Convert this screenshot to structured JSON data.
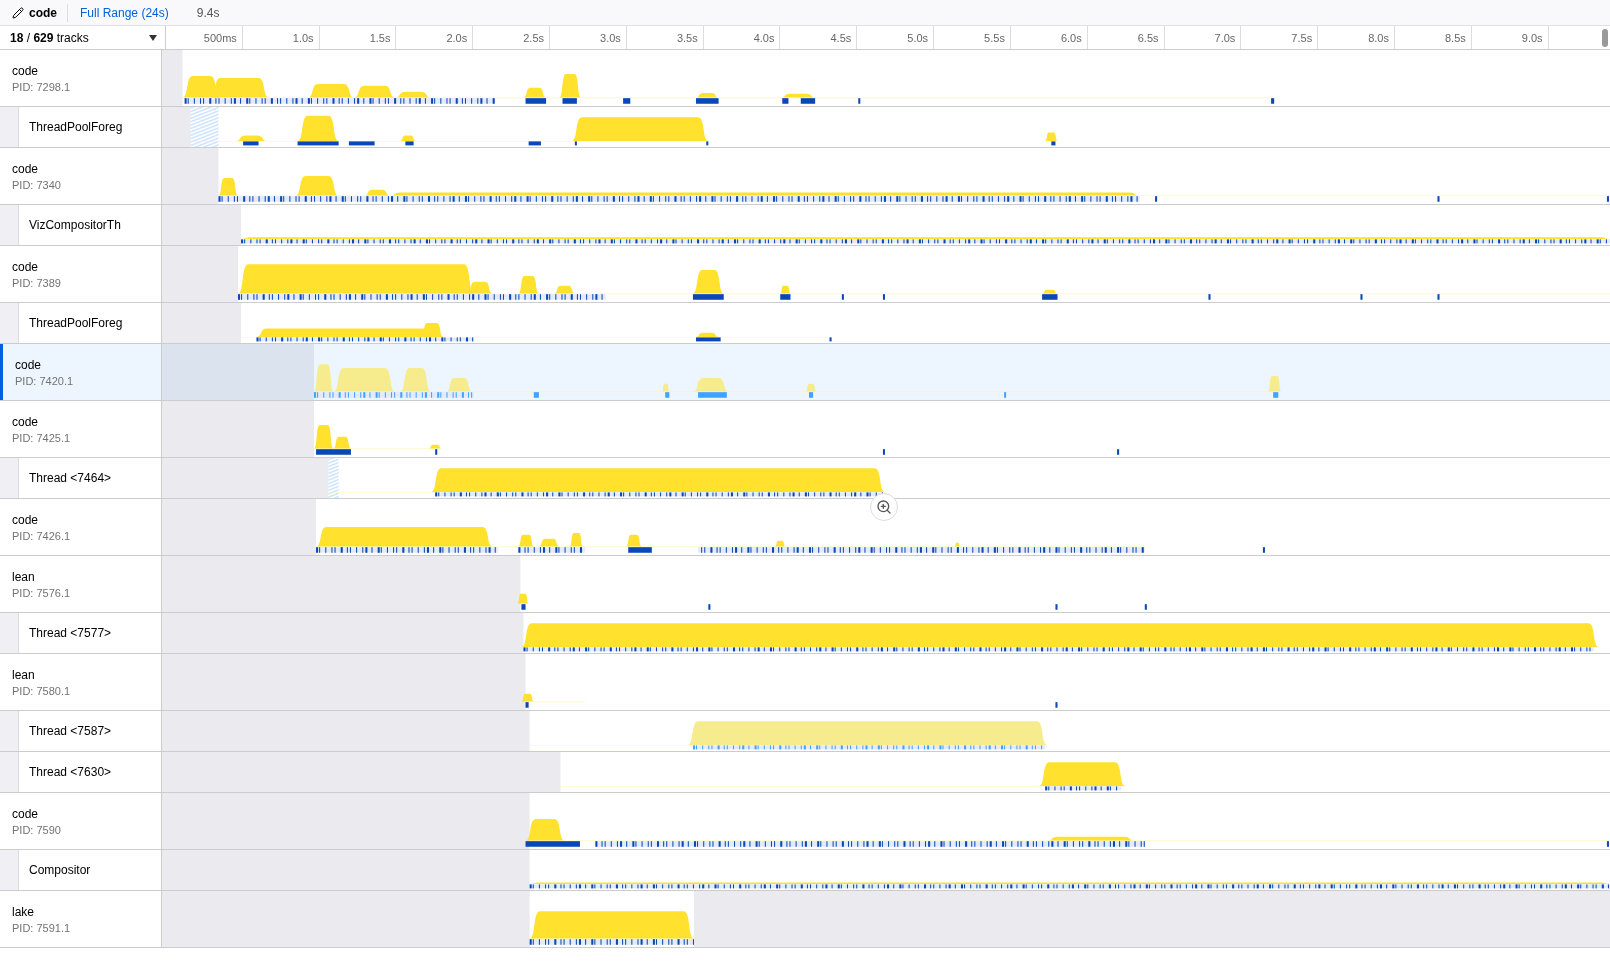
{
  "toolbar": {
    "breadcrumb": "code",
    "range": "Full Range (24s)",
    "duration": "9.4s"
  },
  "track_count": {
    "visible": "18",
    "separator": "/",
    "total": "629",
    "label": "tracks"
  },
  "ticks": [
    "500ms",
    "1.0s",
    "1.5s",
    "2.0s",
    "2.5s",
    "3.0s",
    "3.5s",
    "4.0s",
    "4.5s",
    "5.0s",
    "5.5s",
    "6.0s",
    "6.5s",
    "7.0s",
    "7.5s",
    "8.0s",
    "8.5s",
    "9.0s"
  ],
  "tracks": [
    {
      "kind": "process",
      "name": "code",
      "pid": "PID: 7298.1",
      "selected": false
    },
    {
      "kind": "thread",
      "name": "ThreadPoolForeg",
      "selected": false
    },
    {
      "kind": "process",
      "name": "code",
      "pid": "PID: 7340",
      "selected": false
    },
    {
      "kind": "thread",
      "name": "VizCompositorTh",
      "selected": false
    },
    {
      "kind": "process",
      "name": "code",
      "pid": "PID: 7389",
      "selected": false
    },
    {
      "kind": "thread",
      "name": "ThreadPoolForeg",
      "selected": false
    },
    {
      "kind": "process",
      "name": "code",
      "pid": "PID: 7420.1",
      "selected": true
    },
    {
      "kind": "process",
      "name": "code",
      "pid": "PID: 7425.1",
      "selected": false
    },
    {
      "kind": "thread",
      "name": "Thread <7464>",
      "selected": false
    },
    {
      "kind": "process",
      "name": "code",
      "pid": "PID: 7426.1",
      "selected": false
    },
    {
      "kind": "process",
      "name": "lean",
      "pid": "PID: 7576.1",
      "selected": false
    },
    {
      "kind": "thread",
      "name": "Thread <7577>",
      "selected": false
    },
    {
      "kind": "process",
      "name": "lean",
      "pid": "PID: 7580.1",
      "selected": false
    },
    {
      "kind": "thread",
      "name": "Thread <7587>",
      "selected": false
    },
    {
      "kind": "thread",
      "name": "Thread <7630>",
      "selected": false
    },
    {
      "kind": "process",
      "name": "code",
      "pid": "PID: 7590",
      "selected": false
    },
    {
      "kind": "thread",
      "name": "Compositor",
      "selected": false
    },
    {
      "kind": "process",
      "name": "lake",
      "pid": "PID: 7591.1",
      "selected": false
    }
  ]
}
